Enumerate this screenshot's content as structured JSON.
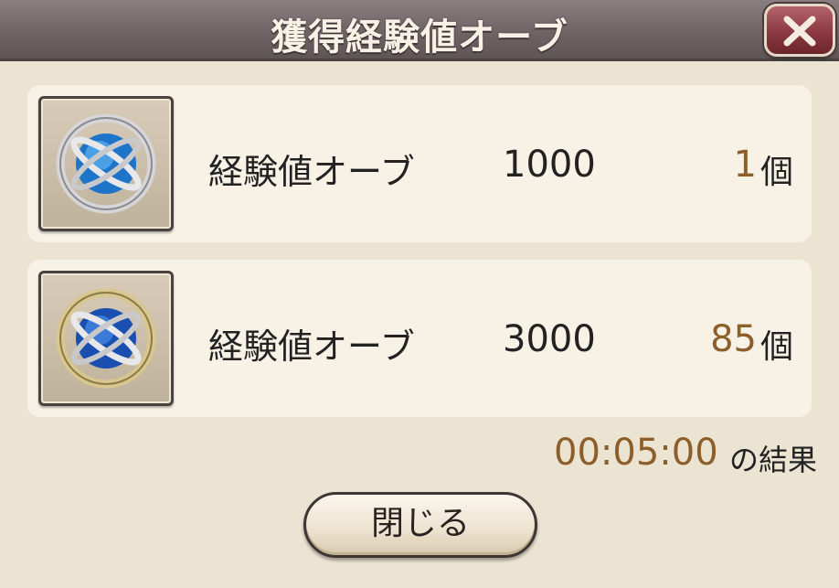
{
  "dialog": {
    "title": "獲得経験値オーブ",
    "close_icon": "close-x-icon"
  },
  "items": [
    {
      "icon": "exp-orb-icon",
      "name": "経験値オーブ",
      "value": "1000",
      "count": "1",
      "unit": "個"
    },
    {
      "icon": "exp-orb-icon",
      "name": "経験値オーブ",
      "value": "3000",
      "count": "85",
      "unit": "個"
    }
  ],
  "result": {
    "time": "00:05:00",
    "label": "の結果"
  },
  "footer": {
    "close_label": "閉じる"
  },
  "colors": {
    "accent": "#8b5e2a",
    "title_bar": "#6f6566",
    "close_red": "#8c3940"
  }
}
